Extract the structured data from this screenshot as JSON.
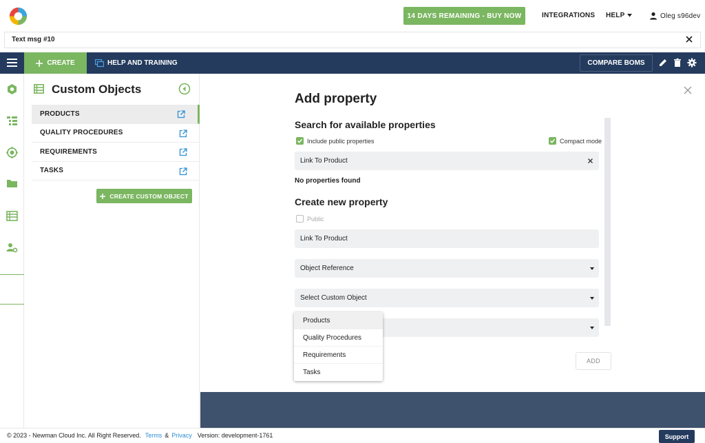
{
  "header": {
    "trial_label": "14 DAYS REMAINING - BUY NOW",
    "integrations_label": "INTEGRATIONS",
    "help_label": "HELP",
    "user_name": "Oleg s96dev"
  },
  "tab": {
    "title": "Text msg #10"
  },
  "navbar": {
    "create_label": "CREATE",
    "help_training_label": "HELP AND TRAINING",
    "compare_boms_label": "COMPARE BOMS"
  },
  "sidebar": {
    "title": "Custom Objects",
    "items": [
      {
        "label": "PRODUCTS",
        "active": true
      },
      {
        "label": "QUALITY PROCEDURES"
      },
      {
        "label": "REQUIREMENTS"
      },
      {
        "label": "TASKS"
      }
    ],
    "create_button_label": "CREATE CUSTOM OBJECT"
  },
  "dialog": {
    "title": "Add property",
    "search_heading": "Search for available properties",
    "include_public_label": "Include public properties",
    "compact_mode_label": "Compact mode",
    "search_value": "Link To Product",
    "no_results": "No properties found",
    "create_heading": "Create new property",
    "public_label": "Public",
    "name_value": "Link To Product",
    "type_value": "Object Reference",
    "custom_object_value": "Select Custom Object",
    "add_label": "ADD"
  },
  "dropdown": {
    "options": [
      "Products",
      "Quality Procedures",
      "Requirements",
      "Tasks"
    ]
  },
  "footer": {
    "copyright": "© 2023 - Newman Cloud Inc. All Right Reserved.",
    "terms": "Terms",
    "amp": "&",
    "privacy": "Privacy",
    "version": "Version: development-1761",
    "support_label": "Support"
  },
  "colors": {
    "accent_green": "#7bb661",
    "navy": "#243b5e",
    "link_blue": "#2c8fd6"
  }
}
